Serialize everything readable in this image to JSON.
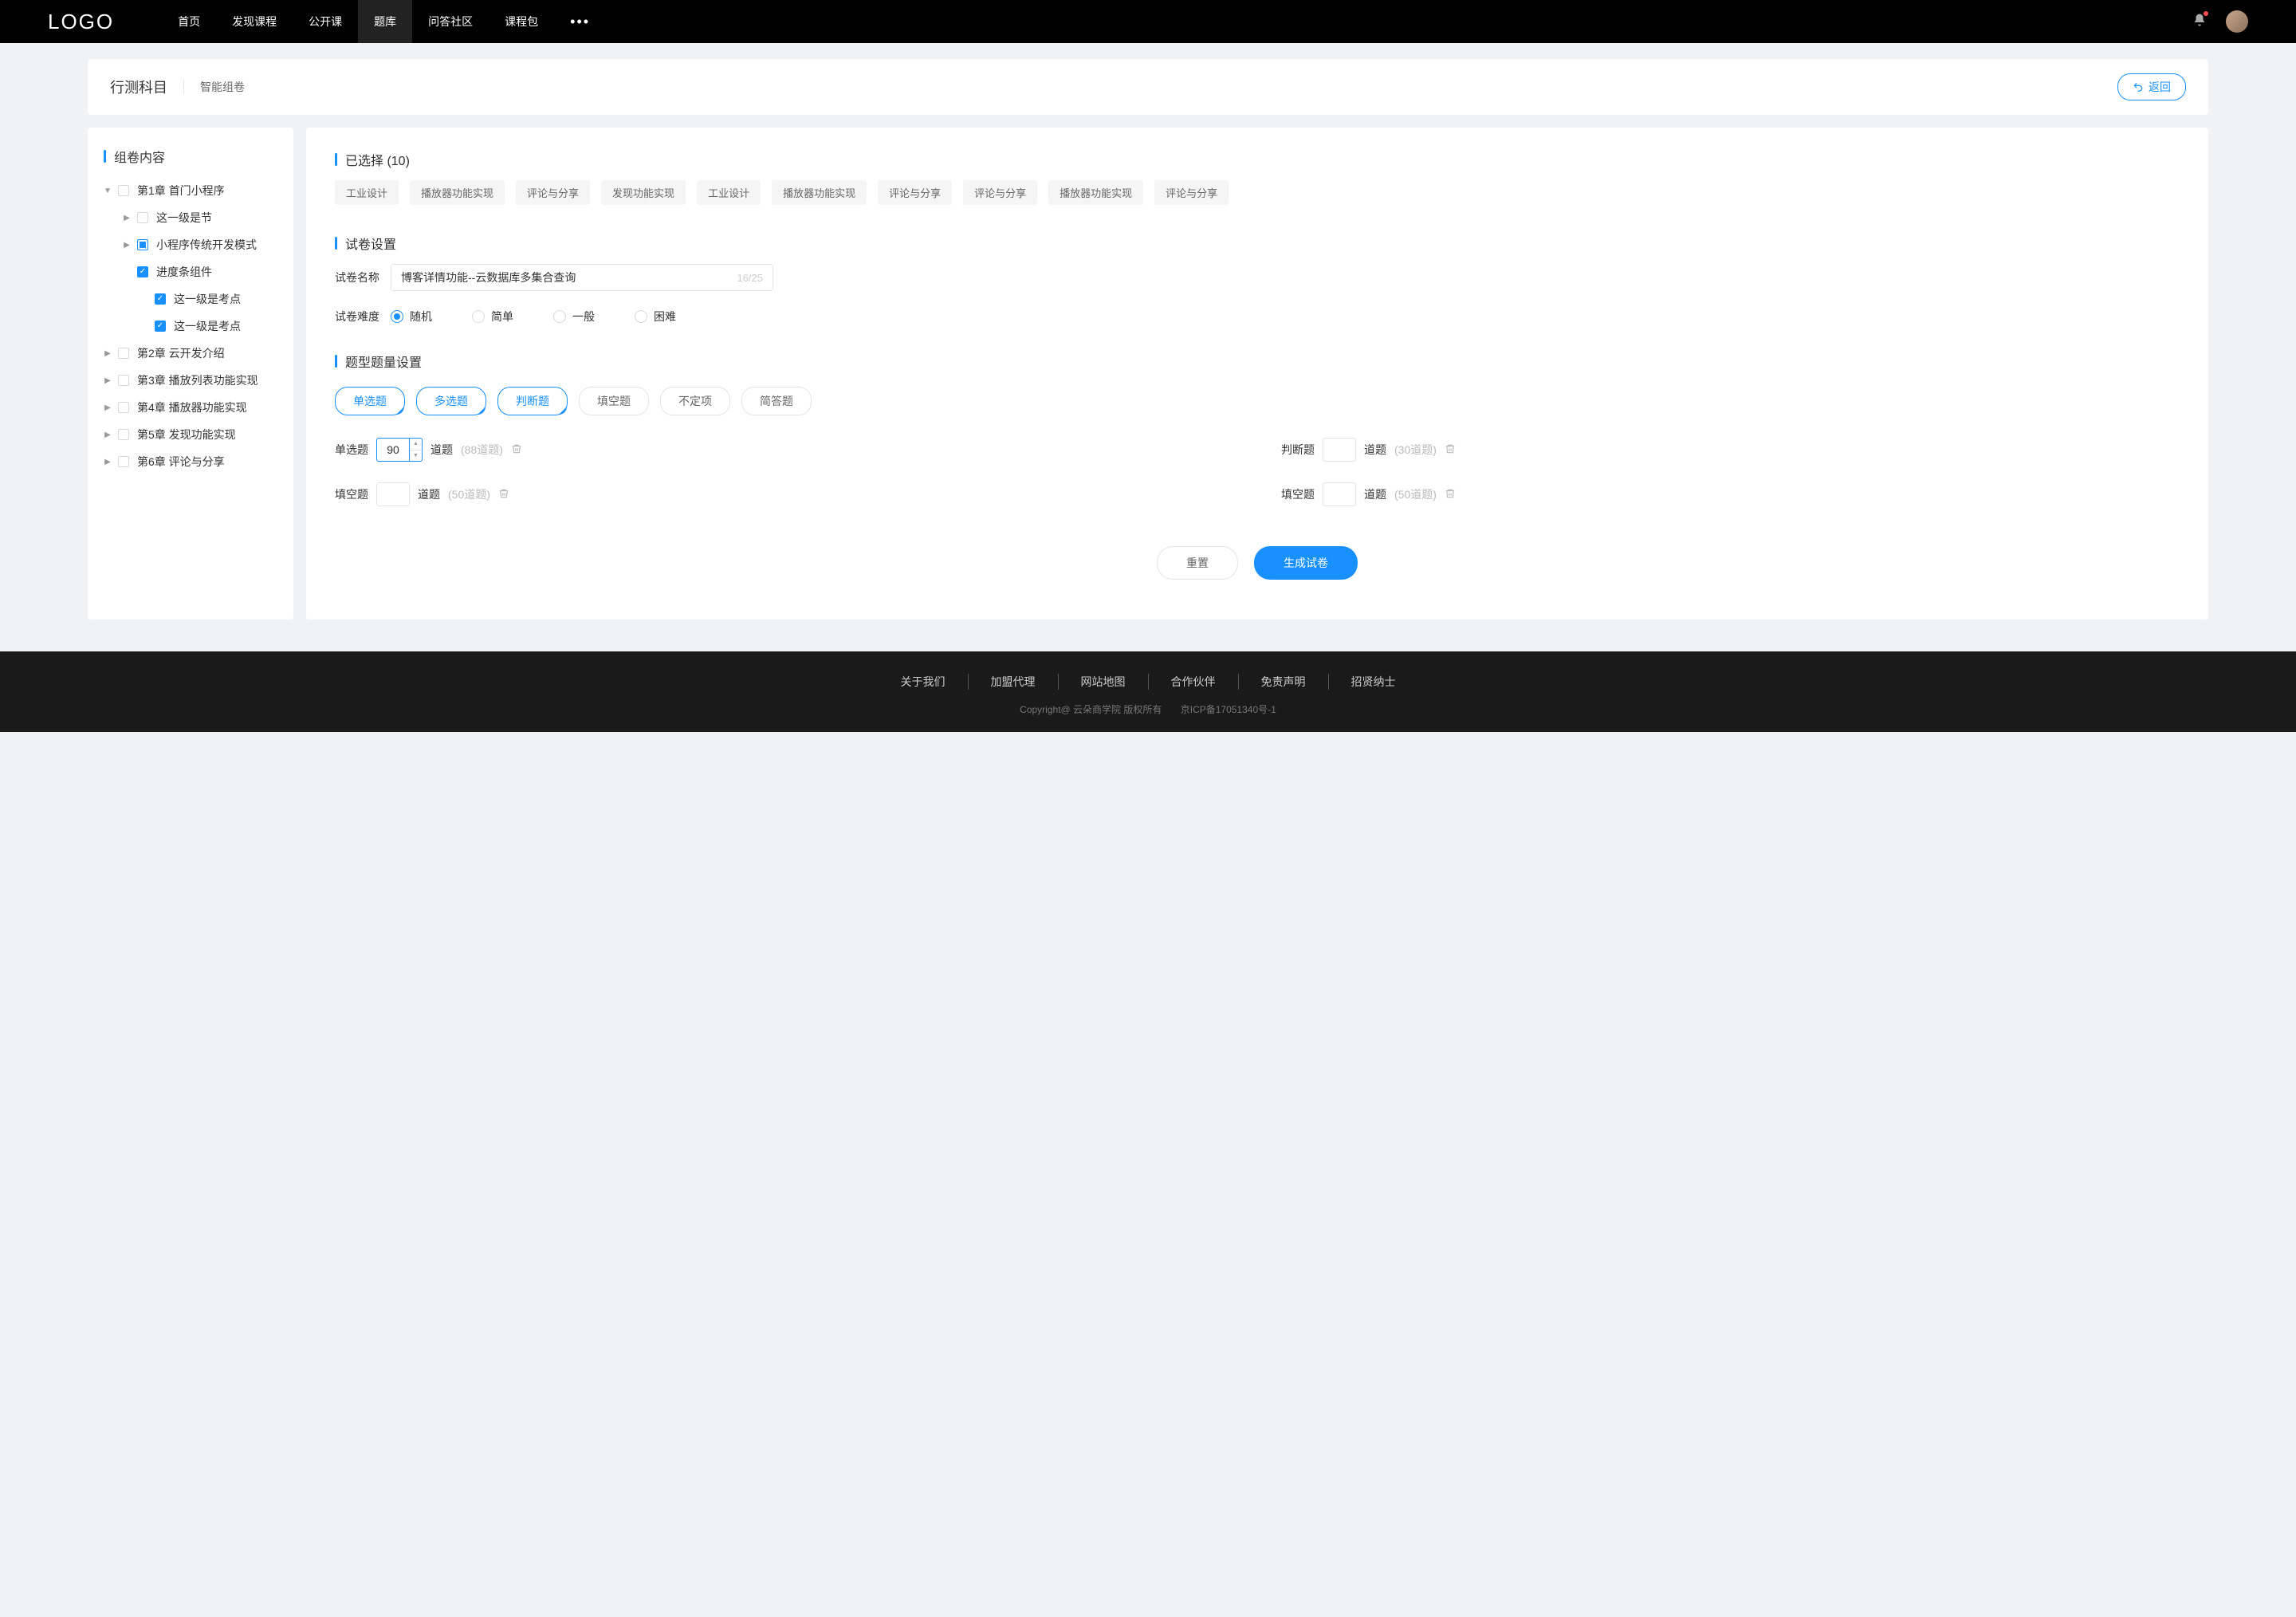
{
  "header": {
    "logo": "LOGO",
    "nav": [
      "首页",
      "发现课程",
      "公开课",
      "题库",
      "问答社区",
      "课程包"
    ],
    "nav_active_index": 3,
    "more": "•••"
  },
  "page": {
    "title": "行测科目",
    "subtitle": "智能组卷",
    "back_label": "返回"
  },
  "sidebar": {
    "title": "组卷内容",
    "tree": [
      {
        "label": "第1章 首门小程序",
        "expanded": true,
        "check": "empty"
      },
      {
        "label": "这一级是节",
        "level": 2,
        "arrow": "right",
        "check": "empty"
      },
      {
        "label": "小程序传统开发模式",
        "level": 2,
        "arrow": "right",
        "check": "half"
      },
      {
        "label": "进度条组件",
        "level": 2,
        "arrow": "none",
        "check": "checked"
      },
      {
        "label": "这一级是考点",
        "level": 3,
        "check": "checked"
      },
      {
        "label": "这一级是考点",
        "level": 3,
        "check": "checked"
      },
      {
        "label": "第2章 云开发介绍",
        "arrow": "right",
        "check": "empty"
      },
      {
        "label": "第3章 播放列表功能实现",
        "arrow": "right",
        "check": "empty"
      },
      {
        "label": "第4章 播放器功能实现",
        "arrow": "right",
        "check": "empty"
      },
      {
        "label": "第5章 发现功能实现",
        "arrow": "right",
        "check": "empty"
      },
      {
        "label": "第6章 评论与分享",
        "arrow": "right",
        "check": "empty"
      }
    ]
  },
  "selected": {
    "title": "已选择 (10)",
    "tags": [
      "工业设计",
      "播放器功能实现",
      "评论与分享",
      "发现功能实现",
      "工业设计",
      "播放器功能实现",
      "评论与分享",
      "评论与分享",
      "播放器功能实现",
      "评论与分享"
    ]
  },
  "settings": {
    "title": "试卷设置",
    "name_label": "试卷名称",
    "name_value": "博客详情功能--云数据库多集合查询",
    "name_count": "16/25",
    "difficulty_label": "试卷难度",
    "difficulty_options": [
      "随机",
      "简单",
      "一般",
      "困难"
    ],
    "difficulty_selected": 0
  },
  "types": {
    "title": "题型题量设置",
    "pills": [
      {
        "label": "单选题",
        "selected": true
      },
      {
        "label": "多选题",
        "selected": true
      },
      {
        "label": "判断题",
        "selected": true
      },
      {
        "label": "填空题",
        "selected": false
      },
      {
        "label": "不定项",
        "selected": false
      },
      {
        "label": "简答题",
        "selected": false
      }
    ],
    "rows": [
      {
        "label": "单选题",
        "value": "90",
        "unit": "道题",
        "hint": "(88道题)",
        "spinner": true
      },
      {
        "label": "判断题",
        "value": "",
        "unit": "道题",
        "hint": "(30道题)",
        "spinner": false
      },
      {
        "label": "填空题",
        "value": "",
        "unit": "道题",
        "hint": "(50道题)",
        "spinner": false
      },
      {
        "label": "填空题",
        "value": "",
        "unit": "道题",
        "hint": "(50道题)",
        "spinner": false
      }
    ]
  },
  "actions": {
    "reset": "重置",
    "generate": "生成试卷"
  },
  "footer": {
    "links": [
      "关于我们",
      "加盟代理",
      "网站地图",
      "合作伙伴",
      "免责声明",
      "招贤纳士"
    ],
    "copy1": "Copyright@ 云朵商学院   版权所有",
    "copy2": "京ICP备17051340号-1"
  }
}
